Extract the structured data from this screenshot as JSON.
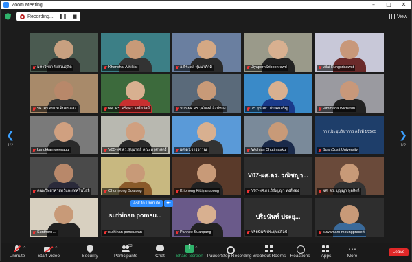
{
  "window": {
    "title": "Zoom Meeting"
  },
  "topbar": {
    "recording_label": "Recording...",
    "pause_glyph": "❚❚",
    "stop_glyph": "■",
    "view_label": "View"
  },
  "nav": {
    "left_arrow": "❮",
    "right_arrow": "❯",
    "page_left": "1/2",
    "page_right": "1/2"
  },
  "participants": [
    {
      "name": "มหาวิทยาลัยสวนดุสิต",
      "bg": "#4a5a50",
      "skin": "#c8a080",
      "shirt": "#222"
    },
    {
      "name": "Khanchai Athikiat",
      "bg": "#3c7f86",
      "skin": "#c89a78",
      "shirt": "#333"
    },
    {
      "name": "อ.ธีระพล ทุ่มมาศักดิ์",
      "bg": "#6a7fa0",
      "skin": "#d4a884",
      "shirt": "#2a2a2a",
      "active": true
    },
    {
      "name": "JiyapornSriboonrawd",
      "bg": "#9a9a8a",
      "skin": "#d8b090",
      "shirt": "#222"
    },
    {
      "name": "Vilai Rungsrisawat",
      "bg": "#c8c8d8",
      "skin": "#c8987a",
      "shirt": "#6a2a2a"
    },
    {
      "name": "รศ. ดร.สมภพ จินตนแสง",
      "bg": "#a88a6a",
      "skin": "#b8886a",
      "shirt": "#333"
    },
    {
      "name": "ผศ. ดร. ศรีสุดา วงศ์สวัสดิ์",
      "bg": "#3c6a3c",
      "skin": "#d8b090",
      "shirt": "#c83030"
    },
    {
      "name": "V08-ผศ.ดร.วุฒิพงศ์ สิงห์ทอง",
      "bg": "#5a6a7a",
      "skin": "#c89a78",
      "shirt": "#333"
    },
    {
      "name": "75 สุนันทา กัมพลเจริญ",
      "bg": "#3a8ac8",
      "skin": "#d8b090",
      "shirt": "#1a3a8a"
    },
    {
      "name": "Pimmada Wichasin",
      "bg": "#9a9aa0",
      "skin": "#c8987a",
      "shirt": "#222"
    },
    {
      "name": "kanokkan weeragul",
      "bg": "#7a7a7a",
      "skin": "#d0a080",
      "shirt": "#2a2a2a"
    },
    {
      "name": "V05-ผศ.ดร.สุขุมาลย์ คณะครุศาสตร์",
      "bg": "#b8b8b0",
      "skin": "#d0a080",
      "shirt": "#2a2a2a"
    },
    {
      "name": "ผศ.ดร.จารุวรรณ",
      "bg": "#5a9ad8",
      "skin": "#d8b090",
      "shirt": "#333"
    },
    {
      "name": "Wichian Chutimaskul",
      "bg": "#7a8a9a",
      "skin": "#c89a78",
      "shirt": "#1a2a4a"
    },
    {
      "name": "SuanDusit University",
      "bg": "#1e3e6a",
      "skin": "#1e3e6a",
      "shirt": "#1e3e6a",
      "banner": "การประชุมวิชาการ ครั้งที่ 1/2565"
    },
    {
      "name": "คณะวิทยาศาสตร์และเทคโนโลยี",
      "bg": "#4a4a4a",
      "skin": "#b8886a",
      "shirt": "#2a2a3a"
    },
    {
      "name": "Chomyong Boatong",
      "bg": "#c8b880",
      "skin": "#c89a78",
      "shirt": "#8a5a2a"
    },
    {
      "name": "Kriphong Kittiyanupong",
      "bg": "#5a3a2a",
      "skin": "#c89a78",
      "shirt": "#222"
    },
    {
      "name": "V07-ผศ.ดร.วิณิญญา หงส์ทอง",
      "bg": "#2e2e2e",
      "skin": "#2e2e2e",
      "shirt": "#2e2e2e",
      "big": "V07-ผศ.ดร. วณิชญา..."
    },
    {
      "name": "ผศ. ดร. บุญญา พูลสิงห์",
      "bg": "#6a4a3a",
      "skin": "#c89a78",
      "shirt": "#333"
    },
    {
      "name": "Sunthorn…",
      "bg": "#d8d0c0",
      "skin": "#c89a78",
      "shirt": "#222"
    },
    {
      "name": "suthinan pomsuwan",
      "bg": "#2e2e2e",
      "skin": "#2e2e2e",
      "shirt": "#2e2e2e",
      "big": "suthinan pomsu..."
    },
    {
      "name": "Pannee Suanpang",
      "bg": "#6a5a8a",
      "skin": "#d8b090",
      "shirt": "#222"
    },
    {
      "name": "ปริยนันท์ ประยุทธ์ศิลป์",
      "bg": "#2e2e2e",
      "skin": "#2e2e2e",
      "shirt": "#2e2e2e",
      "big": "ปริยนันท์ ประยุ..."
    },
    {
      "name": "suwamarn moungprasert",
      "bg": "#2e2e2e",
      "skin": "#c89a78",
      "shirt": "#3a6a9a"
    }
  ],
  "popup": {
    "ask_unmute": "Ask to Unmute",
    "more": "•••"
  },
  "toolbar": {
    "unmute": "Unmute",
    "start_video": "Start Video",
    "security": "Security",
    "participants": "Participants",
    "participants_count": "33",
    "chat": "Chat",
    "share_screen": "Share Screen",
    "pause_stop_recording": "Pause/Stop Recording",
    "breakout_rooms": "Breakout Rooms",
    "reactions": "Reactions",
    "apps": "Apps",
    "more": "More",
    "leave": "Leave"
  }
}
